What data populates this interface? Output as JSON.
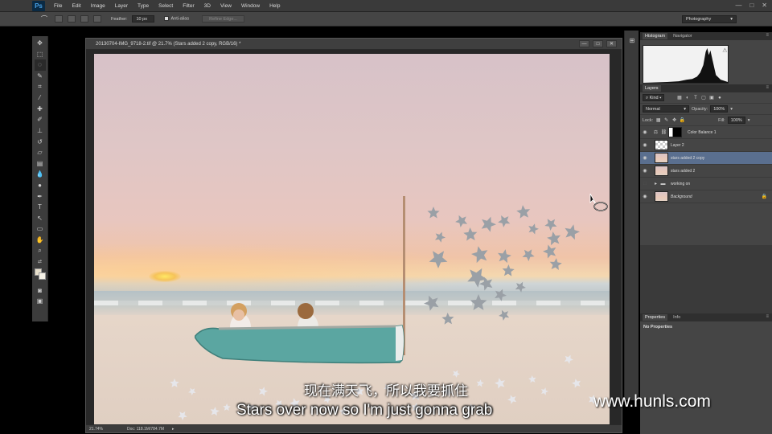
{
  "app": {
    "logo": "Ps"
  },
  "menubar": {
    "items": [
      "File",
      "Edit",
      "Image",
      "Layer",
      "Type",
      "Select",
      "Filter",
      "3D",
      "View",
      "Window",
      "Help"
    ],
    "window_controls": [
      "—",
      "□",
      "✕"
    ]
  },
  "optionsbar": {
    "feather_label": "Feather:",
    "feather_value": "10 px",
    "antialias_label": "Anti-alias",
    "refine_edge_label": "Refine Edge...",
    "workspace": "Photography"
  },
  "document": {
    "title": "20130704-IMG_9718-2.tif @ 21.7% (Stars added 2 copy, RGB/16) *",
    "controls": [
      "—",
      "□",
      "✕"
    ],
    "status_zoom": "21.74%",
    "status_doc": "Doc: 118.1M/784.7M"
  },
  "histogram_panel": {
    "tabs": [
      "Histogram",
      "Navigator"
    ]
  },
  "layers_panel": {
    "tab": "Layers",
    "filter_kind": "Kind",
    "blend_mode": "Normal",
    "opacity_label": "Opacity:",
    "opacity_value": "100%",
    "lock_label": "Lock:",
    "fill_label": "Fill:",
    "fill_value": "100%",
    "layers": [
      {
        "name": "Color Balance 1",
        "visible": true,
        "selected": false
      },
      {
        "name": "Layer 2",
        "visible": true,
        "selected": false
      },
      {
        "name": "stars added 2 copy",
        "visible": true,
        "selected": true
      },
      {
        "name": "stars added 2",
        "visible": true,
        "selected": false
      },
      {
        "name": "working on",
        "visible": false,
        "selected": false
      },
      {
        "name": "Background",
        "visible": true,
        "selected": false
      }
    ]
  },
  "properties_panel": {
    "tabs": [
      "Properties",
      "Info"
    ],
    "message": "No Properties"
  },
  "subtitles": {
    "chinese": "现在满天飞，所以我要抓住",
    "english": "Stars over now so I'm just gonna grab"
  },
  "watermark": "www.hunls.com",
  "colors": {
    "selected_layer": "#5a6f8f",
    "boat": "#5ba6a1",
    "panel_bg": "#454545"
  }
}
